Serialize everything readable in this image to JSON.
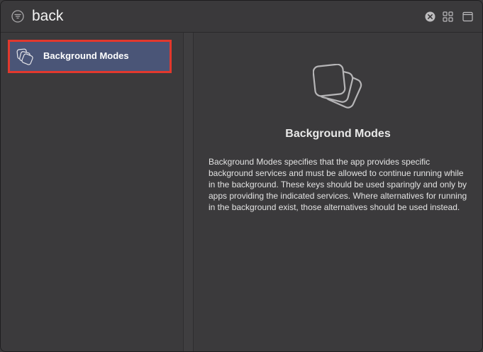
{
  "search": {
    "query": "back",
    "filter_icon": "filter-icon",
    "clear_icon": "clear-icon",
    "grid_icon": "grid-icon",
    "window_icon": "window-icon"
  },
  "list": {
    "items": [
      {
        "label": "Background Modes",
        "icon": "stacked-squares-icon",
        "selected": true
      }
    ],
    "selection_color": "#4a5577",
    "highlight_color": "#e2382d"
  },
  "detail": {
    "icon": "stacked-squares-icon",
    "title": "Background Modes",
    "description": "Background Modes specifies that the app provides specific background services and must be allowed to continue running while in the background. These keys should be used sparingly and only by apps providing the indicated services. Where alternatives for running in the background exist, those alternatives should be used instead."
  }
}
